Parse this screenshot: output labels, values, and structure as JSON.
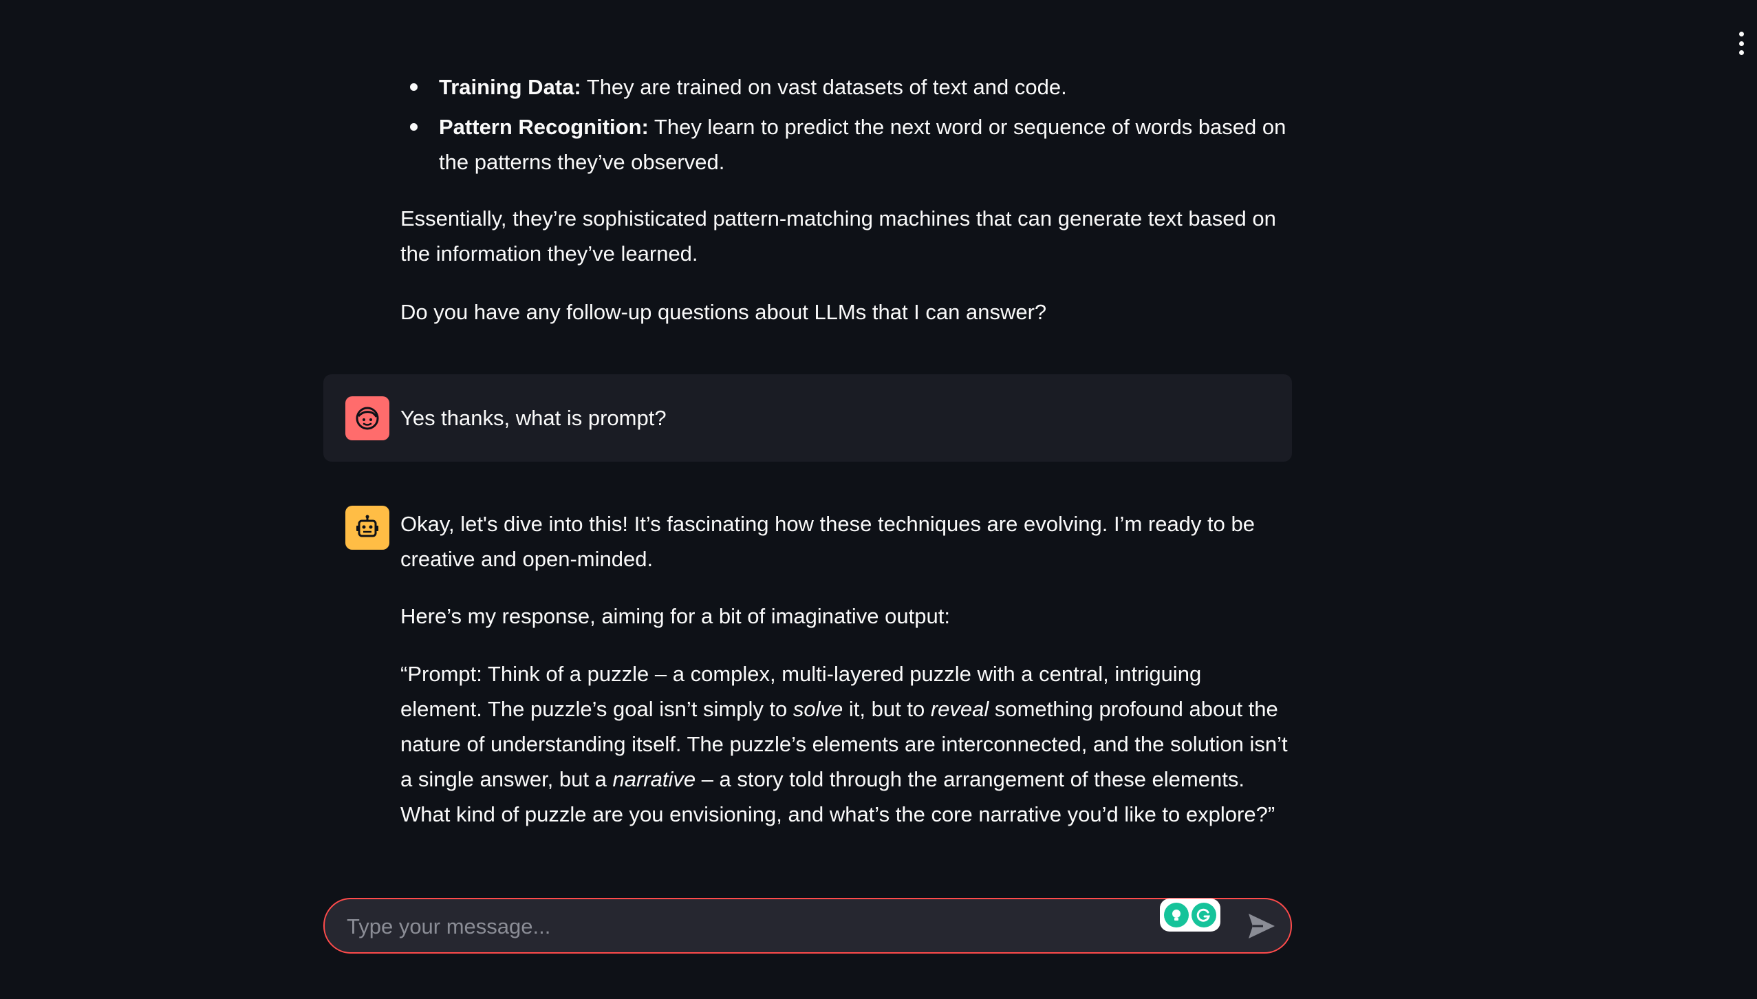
{
  "colors": {
    "background": "#0e1117",
    "user_bubble": "#1a1c24",
    "user_avatar": "#ff6c6c",
    "bot_avatar": "#ffbd45",
    "input_border": "#ff4b4b",
    "text": "#fafafa"
  },
  "previous_reply": {
    "bullets": [
      {
        "term": "Training Data:",
        "text": " They are trained on vast datasets of text and code."
      },
      {
        "term": "Pattern Recognition:",
        "text": " They learn to predict the next word or sequence of words based on the patterns they’ve observed."
      }
    ],
    "summary": "Essentially, they’re sophisticated pattern-matching machines that can generate text based on the information they’ve learned.",
    "followup": "Do you have any follow-up questions about LLMs that I can answer?"
  },
  "user_message": {
    "avatar_icon": "face-icon",
    "text": "Yes thanks, what is prompt?"
  },
  "assistant_message": {
    "avatar_icon": "robot-icon",
    "p1": "Okay, let's dive into this! It’s fascinating how these techniques are evolving. I’m ready to be creative and open-minded.",
    "p2": "Here’s my response, aiming for a bit of imaginative output:",
    "p3": {
      "a": "“Prompt: Think of a puzzle – a complex, multi-layered puzzle with a central, intriguing element. The puzzle’s goal isn’t simply to ",
      "em1": "solve",
      "b": " it, but to ",
      "em2": "reveal",
      "c": " something profound about the nature of understanding itself. The puzzle’s elements are interconnected, and the solution isn’t a single answer, but a ",
      "em3": "narrative",
      "d": " – a story told through the arrangement of these elements. What kind of puzzle are you envisioning, and what’s the core narrative you’d like to explore?”"
    }
  },
  "input": {
    "placeholder": "Type your message...",
    "value": "",
    "extension_icons": [
      "bulb-icon",
      "grammarly-icon"
    ],
    "send_icon": "send-icon"
  },
  "header": {
    "menu_icon": "vertical-dots-icon"
  }
}
